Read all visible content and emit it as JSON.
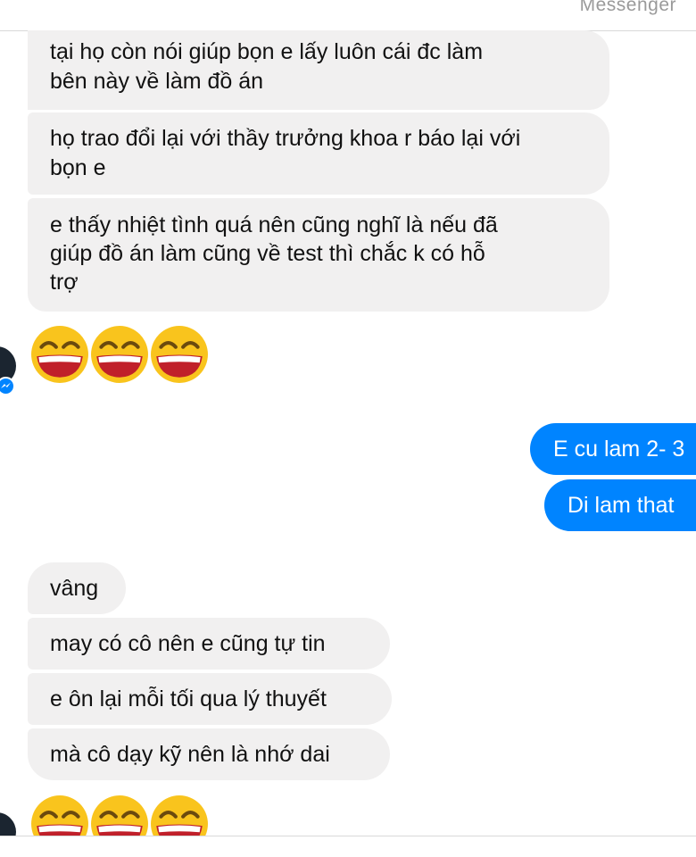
{
  "app": {
    "title": "Messenger"
  },
  "messages": {
    "in_group_1": [
      {
        "line1": "tại họ còn nói giúp bọn e lấy luôn cái đc làm",
        "line2": "bên này về làm đồ án"
      },
      {
        "line1": "họ trao đổi lại với thầy trưởng khoa r báo lại với",
        "line2": "bọn e"
      },
      {
        "line1": "e thấy nhiệt tình quá nên cũng nghĩ là nếu đã",
        "line2": "giúp đồ án làm cũng về test thì chắc k có hỗ",
        "line3": "trợ"
      }
    ],
    "out_group": [
      {
        "text": "E cu lam 2- 3"
      },
      {
        "text": "Di lam that"
      }
    ],
    "in_group_2": [
      {
        "text": "vâng"
      },
      {
        "text": "may có cô nên e cũng tự tin"
      },
      {
        "text": "e ôn lại mỗi tối qua lý thuyết"
      },
      {
        "text": "mà cô dạy kỹ nên là nhớ dai"
      }
    ]
  },
  "emoji": {
    "name": "grinning-squint-emoji",
    "count": 3
  },
  "colors": {
    "incoming_bubble": "#f1f0f0",
    "outgoing_bubble": "#0084ff",
    "emoji_face": "#f9c41d",
    "emoji_mouth": "#c0202a"
  }
}
